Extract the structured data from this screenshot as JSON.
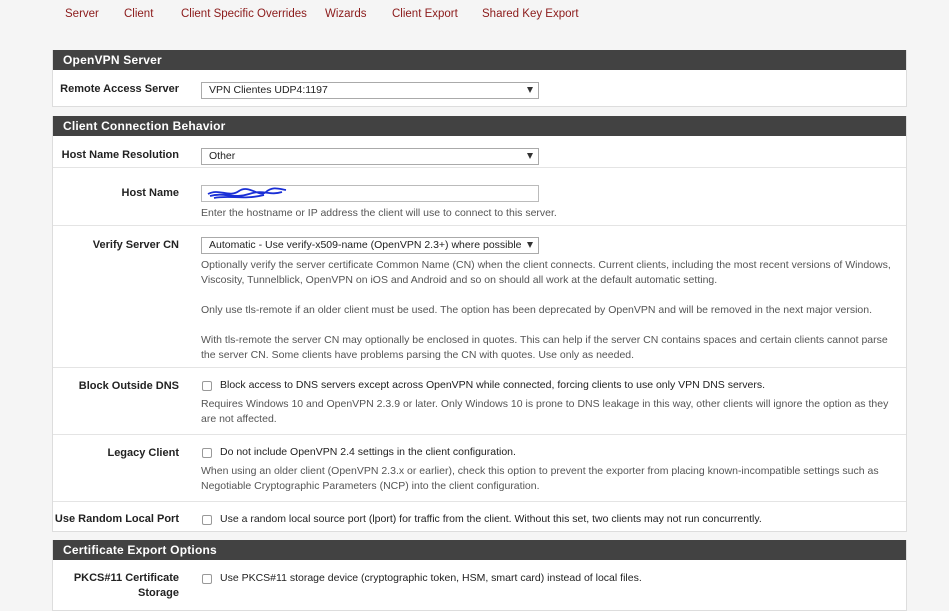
{
  "tabs": [
    "Server",
    "Client",
    "Client Specific Overrides",
    "Wizards",
    "Client Export",
    "Shared Key Export"
  ],
  "openvpn_server": {
    "heading": "OpenVPN Server",
    "remote_access_label": "Remote Access Server",
    "remote_access_value": "VPN Clientes UDP4:1197"
  },
  "client_connection": {
    "heading": "Client Connection Behavior",
    "host_name_resolution_label": "Host Name Resolution",
    "host_name_resolution_value": "Other",
    "host_name_label": "Host Name",
    "host_name_help": "Enter the hostname or IP address the client will use to connect to this server.",
    "verify_cn_label": "Verify Server CN",
    "verify_cn_value": "Automatic - Use verify-x509-name (OpenVPN 2.3+) where possible",
    "verify_cn_help1": "Optionally verify the server certificate Common Name (CN) when the client connects. Current clients, including the most recent versions of Windows, Viscosity, Tunnelblick, OpenVPN on iOS and Android and so on should all work at the default automatic setting.",
    "verify_cn_help2": "Only use tls-remote if an older client must be used. The option has been deprecated by OpenVPN and will be removed in the next major version.",
    "verify_cn_help3": "With tls-remote the server CN may optionally be enclosed in quotes. This can help if the server CN contains spaces and certain clients cannot parse the server CN. Some clients have problems parsing the CN with quotes. Use only as needed.",
    "block_dns_label": "Block Outside DNS",
    "block_dns_checkbox": "Block access to DNS servers except across OpenVPN while connected, forcing clients to use only VPN DNS servers.",
    "block_dns_help": "Requires Windows 10 and OpenVPN 2.3.9 or later. Only Windows 10 is prone to DNS leakage in this way, other clients will ignore the option as they are not affected.",
    "legacy_label": "Legacy Client",
    "legacy_checkbox": "Do not include OpenVPN 2.4 settings in the client configuration.",
    "legacy_help": "When using an older client (OpenVPN 2.3.x or earlier), check this option to prevent the exporter from placing known-incompatible settings such as Negotiable Cryptographic Parameters (NCP) into the client configuration.",
    "random_port_label": "Use Random Local Port",
    "random_port_checkbox": "Use a random local source port (lport) for traffic from the client. Without this set, two clients may not run concurrently."
  },
  "certificate_export": {
    "heading": "Certificate Export Options",
    "pkcs_label": "PKCS#11 Certificate Storage",
    "pkcs_checkbox": "Use PKCS#11 storage device (cryptographic token, HSM, smart card) instead of local files."
  },
  "colors": {
    "tab_link": "#8b1a1a",
    "panel_heading_bg": "#424242",
    "redaction_scribble": "#1a2fd6"
  }
}
